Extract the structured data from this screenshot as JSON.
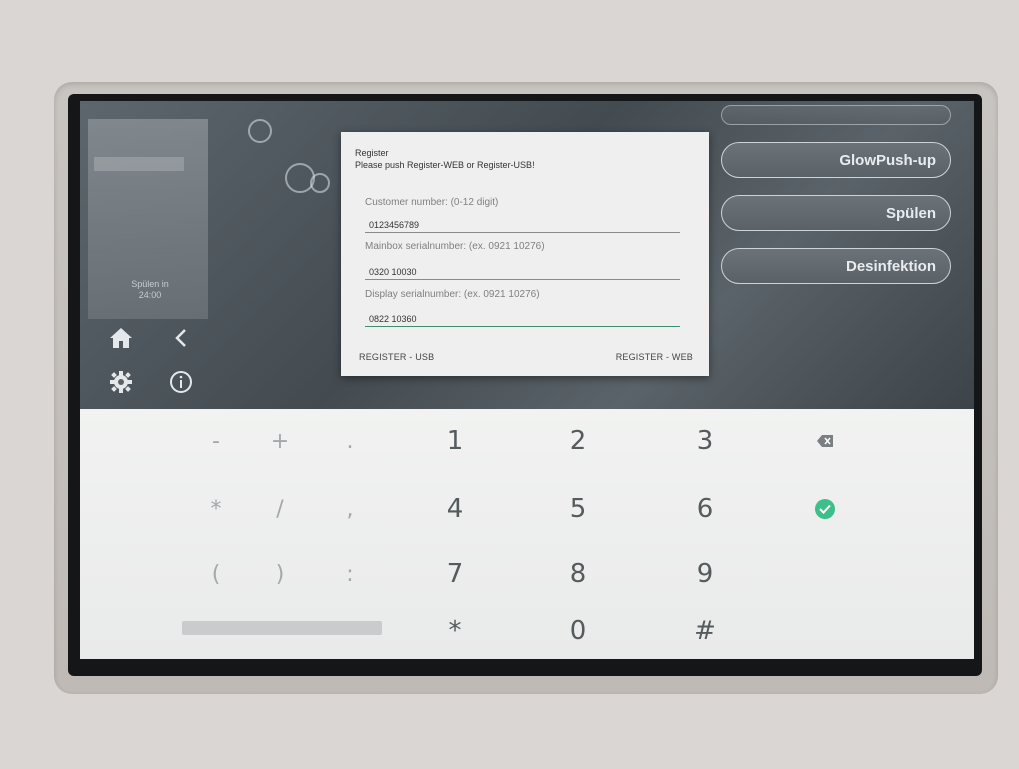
{
  "background_app": {
    "status_text": [
      "Spülen in",
      "24:00"
    ],
    "right_buttons": [
      {
        "label": "GlowPush-up"
      },
      {
        "label": "Spülen"
      },
      {
        "label": "Desinfektion"
      }
    ]
  },
  "dialog": {
    "title": "Register",
    "message": "Please push Register-WEB or Register-USB!",
    "fields": [
      {
        "label": "Customer number: (0-12 digit)",
        "value": "0123456789"
      },
      {
        "label": "Mainbox serialnumber: (ex. 0921 10276)",
        "value": "0320 10030"
      },
      {
        "label": "Display serialnumber: (ex. 0921 10276)",
        "value": "0822 10360"
      }
    ],
    "register_usb_label": "REGISTER - USB",
    "register_web_label": "REGISTER - WEB"
  },
  "keypad": {
    "rows": [
      [
        "-",
        "+",
        ".",
        "1",
        "2",
        "3"
      ],
      [
        "*",
        "/",
        ",",
        "4",
        "5",
        "6"
      ],
      [
        "(",
        ")",
        ":",
        "7",
        "8",
        "9"
      ],
      [
        "*",
        "0",
        "#"
      ]
    ],
    "backspace_icon": "backspace-icon",
    "confirm_icon": "check-circle-icon"
  },
  "colors": {
    "accent_green": "#3dbf8a",
    "field_focus": "#3f8f6f"
  }
}
